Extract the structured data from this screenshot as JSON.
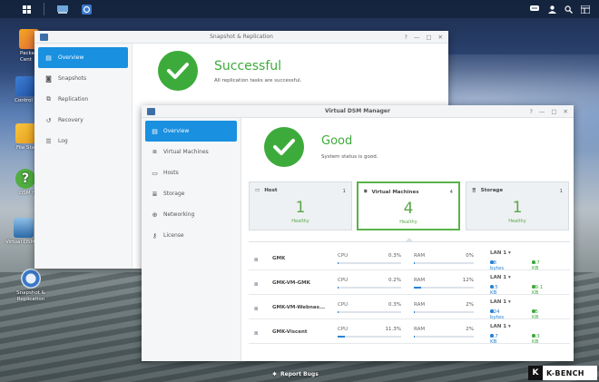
{
  "taskbar": {
    "main_menu_icon": "grid-icon",
    "apps": [
      "virtual-dsm-icon",
      "snapshot-icon"
    ]
  },
  "desktop": {
    "icons": [
      {
        "label": "Package Center",
        "label_visible": "Packa\nCent",
        "icon": "package-icon"
      },
      {
        "label": "Control Panel",
        "label_visible": "Control",
        "icon": "control-panel-icon"
      },
      {
        "label": "File Station",
        "label_visible": "File Sta",
        "icon": "folder-icon"
      },
      {
        "label": "DSM Help",
        "label_visible": "DSM H",
        "icon": "help-icon"
      },
      {
        "label": "Virtual DSM",
        "label_visible": "Virtual DSM",
        "icon": "virtual-dsm-icon"
      },
      {
        "label": "Snapshot & Replication",
        "label_visible": "Snapshot &\nReplication",
        "icon": "snapshot-icon"
      }
    ]
  },
  "snapshot_window": {
    "title": "Snapshot & Replication",
    "nav": [
      {
        "label": "Overview",
        "icon": "overview-icon"
      },
      {
        "label": "Snapshots",
        "icon": "camera-icon"
      },
      {
        "label": "Replication",
        "icon": "replication-icon"
      },
      {
        "label": "Recovery",
        "icon": "recovery-icon"
      },
      {
        "label": "Log",
        "icon": "log-icon"
      }
    ],
    "status_title": "Successful",
    "status_text": "All replication tasks are successful."
  },
  "vdsm_window": {
    "title": "Virtual DSM Manager",
    "nav": [
      {
        "label": "Overview",
        "icon": "overview-icon"
      },
      {
        "label": "Virtual Machines",
        "icon": "vm-icon"
      },
      {
        "label": "Hosts",
        "icon": "host-icon"
      },
      {
        "label": "Storage",
        "icon": "storage-icon"
      },
      {
        "label": "Networking",
        "icon": "network-icon"
      },
      {
        "label": "License",
        "icon": "key-icon"
      }
    ],
    "status_title": "Good",
    "status_text": "System status is good.",
    "cards": [
      {
        "label": "Host",
        "count": "1",
        "big": "1",
        "status": "Healthy"
      },
      {
        "label": "Virtual Machines",
        "count": "4",
        "big": "4",
        "status": "Healthy"
      },
      {
        "label": "Storage",
        "count": "1",
        "big": "1",
        "status": "Healthy"
      }
    ],
    "vms": [
      {
        "name": "GMK",
        "cpu_label": "CPU",
        "cpu": "0.3%",
        "cpu_frac": 0.003,
        "ram_label": "RAM",
        "ram": "0%",
        "ram_frac": 0.0,
        "lan": "LAN 1 ▾",
        "up": "28 bytes",
        "down": "3.7 KB"
      },
      {
        "name": "GMK-VM-GMK",
        "cpu_label": "CPU",
        "cpu": "0.2%",
        "cpu_frac": 0.002,
        "ram_label": "RAM",
        "ram": "12%",
        "ram_frac": 0.12,
        "lan": "LAN 1 ▾",
        "up": "4.5 KB",
        "down": "49.1 KB"
      },
      {
        "name": "GMK-VM-Webnas...",
        "cpu_label": "CPU",
        "cpu": "0.3%",
        "cpu_frac": 0.003,
        "ram_label": "RAM",
        "ram": "2%",
        "ram_frac": 0.02,
        "lan": "LAN 1 ▾",
        "up": "624 bytes",
        "down": "45 KB"
      },
      {
        "name": "GMK-Viscent",
        "cpu_label": "CPU",
        "cpu": "11.3%",
        "cpu_frac": 0.113,
        "ram_label": "RAM",
        "ram": "2%",
        "ram_frac": 0.02,
        "lan": "LAN 1 ▾",
        "up": "1.7 KB",
        "down": "8.3 KB"
      }
    ]
  },
  "report_bugs": "Report Bugs",
  "watermark": "K-BENCH",
  "colors": {
    "accent": "#1990e0",
    "ok": "#3dab3b",
    "healthy": "#5aa64a",
    "bar": "#2a83d3"
  }
}
